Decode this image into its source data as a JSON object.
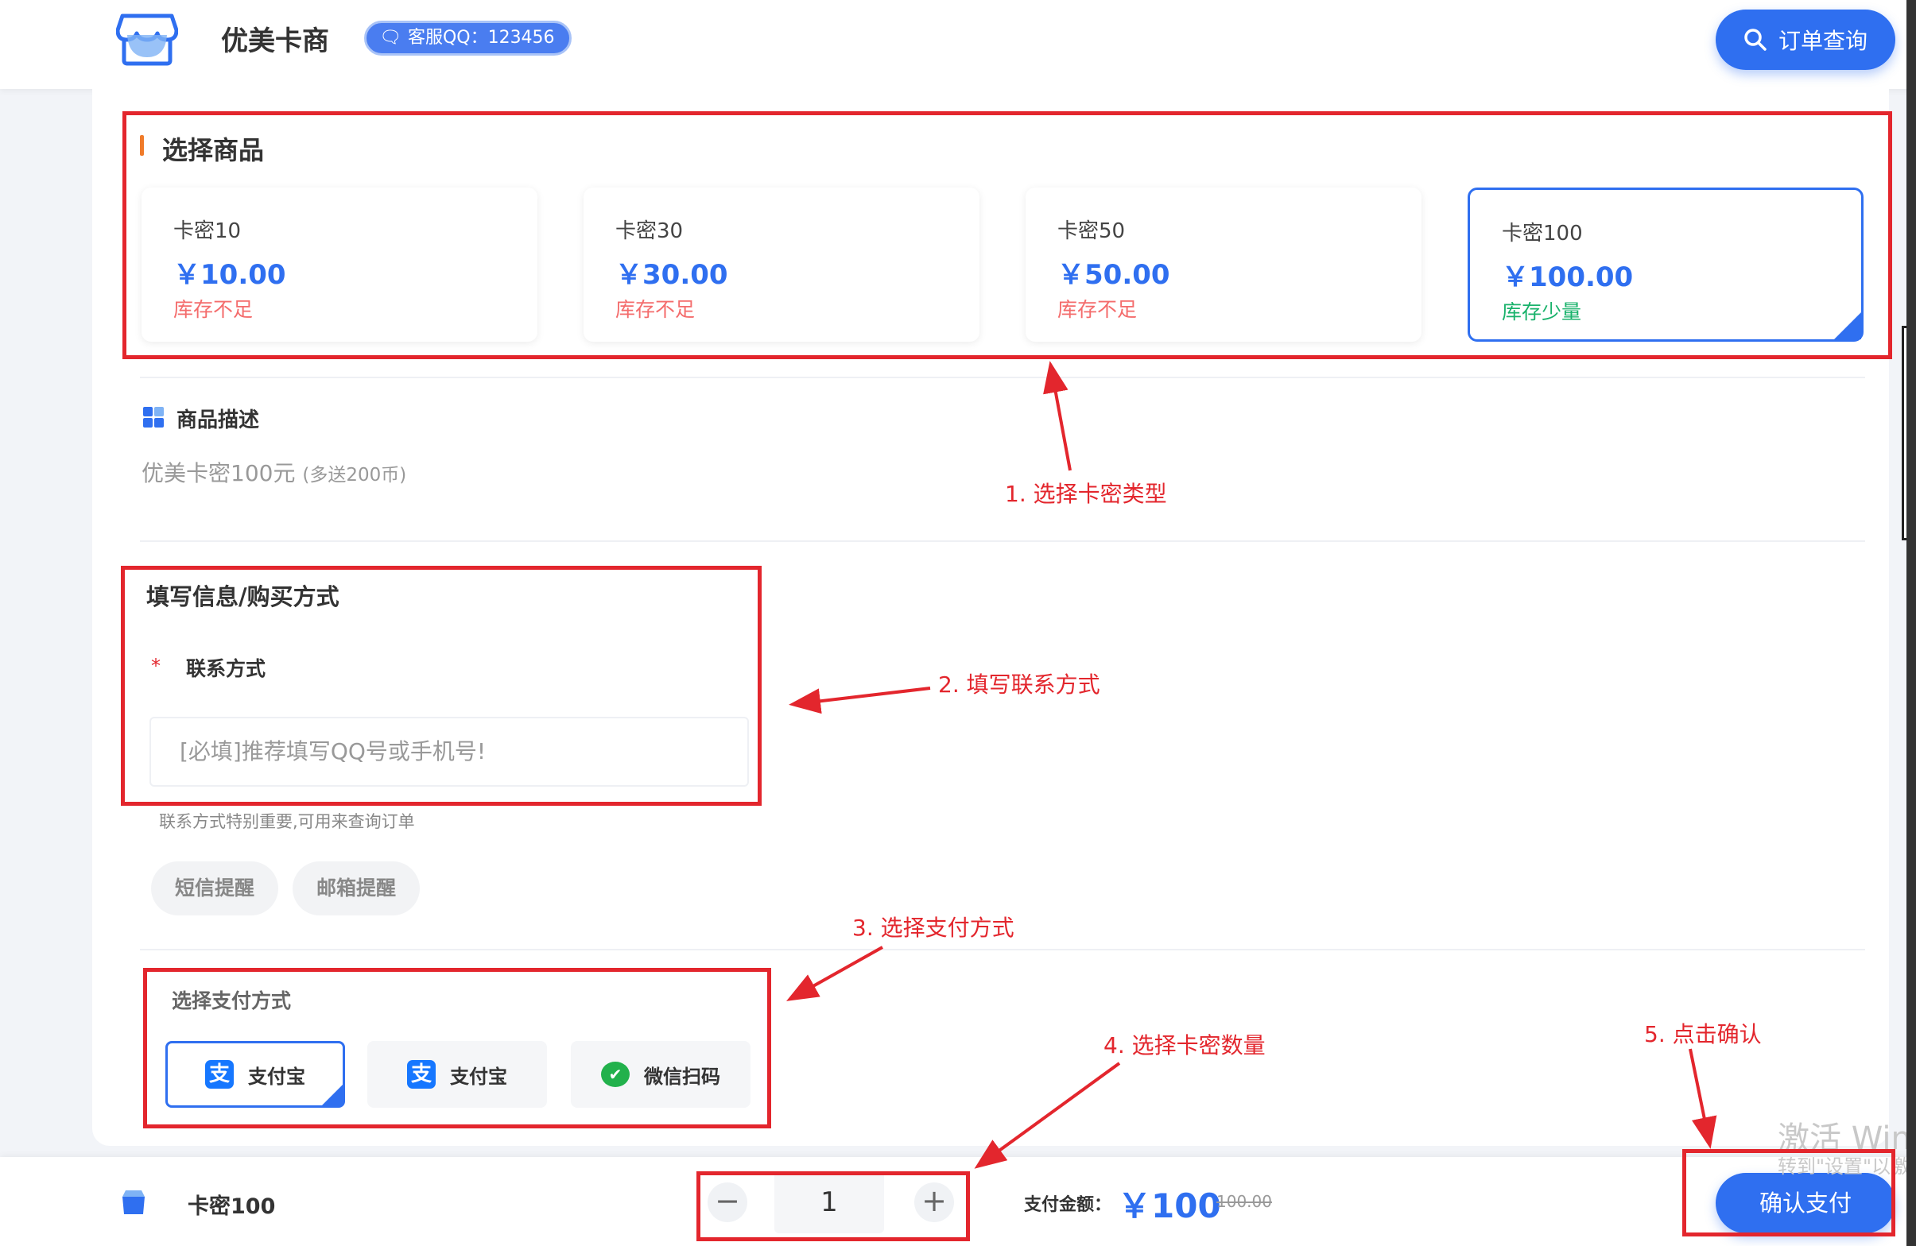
{
  "header": {
    "brand_name": "优美卡商",
    "qq_badge": "客服QQ：123456",
    "order_query": "订单查询"
  },
  "products": {
    "section_title": "选择商品",
    "items": [
      {
        "name": "卡密10",
        "price": "￥10.00",
        "stock": "库存不足",
        "stock_color": "#f46c6c",
        "selected": false
      },
      {
        "name": "卡密30",
        "price": "￥30.00",
        "stock": "库存不足",
        "stock_color": "#f46c6c",
        "selected": false
      },
      {
        "name": "卡密50",
        "price": "￥50.00",
        "stock": "库存不足",
        "stock_color": "#f46c6c",
        "selected": false
      },
      {
        "name": "卡密100",
        "price": "￥100.00",
        "stock": "库存少量",
        "stock_color": "#19b26b",
        "selected": true
      }
    ]
  },
  "description": {
    "title": "商品描述",
    "main": "优美卡密100元",
    "extra": "(多送200币)"
  },
  "form": {
    "section_title": "填写信息/购买方式",
    "required_mark": "*",
    "contact_label": "联系方式",
    "contact_placeholder": "[必填]推荐填写QQ号或手机号!",
    "contact_hint": "联系方式特别重要,可用来查询订单",
    "sms_remind": "短信提醒",
    "email_remind": "邮箱提醒"
  },
  "payment": {
    "section_title": "选择支付方式",
    "methods": [
      {
        "label": "支付宝",
        "icon": "alipay-icon",
        "selected": true
      },
      {
        "label": "支付宝",
        "icon": "alipay-icon",
        "selected": false
      },
      {
        "label": "微信扫码",
        "icon": "wechat-icon",
        "selected": false
      }
    ]
  },
  "bottom_bar": {
    "product_name": "卡密100",
    "quantity": "1",
    "minus": "−",
    "plus": "+",
    "amount_label": "支付金额：",
    "amount": "￥100",
    "original_amount": "100.00",
    "confirm": "确认支付"
  },
  "annotations": {
    "step1": "1. 选择卡密类型",
    "step2": "2. 填写联系方式",
    "step3": "3. 选择支付方式",
    "step4": "4. 选择卡密数量",
    "step5": "5. 点击确认"
  },
  "watermark": {
    "line1": "激活 Wind",
    "line2": "转到\"设置\"以激"
  },
  "colors": {
    "accent": "#2f6ff0",
    "annotation": "#e3262d",
    "stock_low": "#f46c6c",
    "stock_ok": "#19b26b"
  }
}
